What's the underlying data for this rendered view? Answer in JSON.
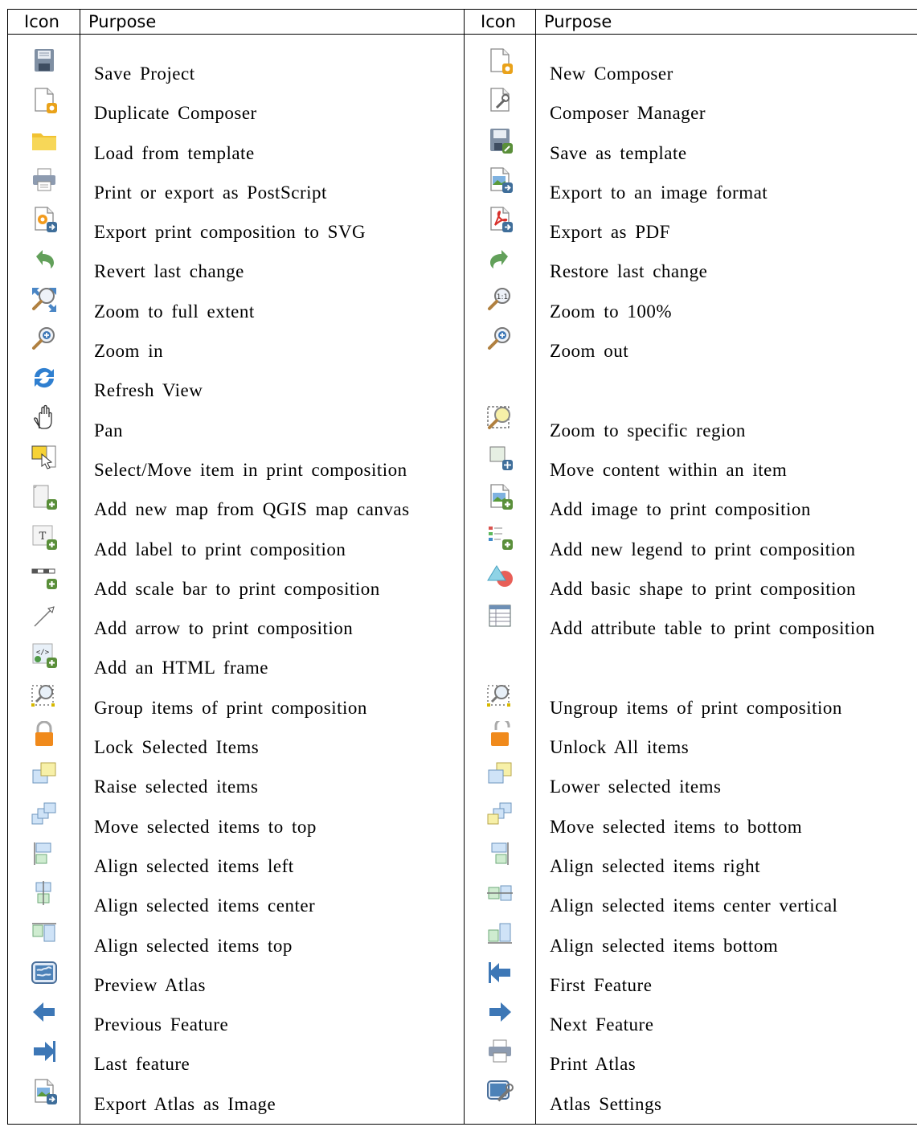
{
  "header": {
    "icon_col_1": "Icon",
    "purpose_col_1": "Purpose",
    "icon_col_2": "Icon",
    "purpose_col_2": "Purpose"
  },
  "rows": [
    {
      "left": {
        "icon": "save-project-icon",
        "label": "Save Project"
      },
      "right": {
        "icon": "new-composer-icon",
        "label": "New Composer"
      }
    },
    {
      "left": {
        "icon": "duplicate-composer-icon",
        "label": "Duplicate Composer"
      },
      "right": {
        "icon": "composer-manager-icon",
        "label": "Composer Manager"
      }
    },
    {
      "left": {
        "icon": "folder-icon",
        "label": "Load from template"
      },
      "right": {
        "icon": "save-template-icon",
        "label": "Save as template"
      }
    },
    {
      "left": {
        "icon": "printer-icon",
        "label": "Print or export as PostScript"
      },
      "right": {
        "icon": "export-image-icon",
        "label": "Export to an image format"
      }
    },
    {
      "left": {
        "icon": "export-svg-icon",
        "label": "Export print composition to SVG"
      },
      "right": {
        "icon": "export-pdf-icon",
        "label": "Export as PDF"
      }
    },
    {
      "left": {
        "icon": "undo-icon",
        "label": "Revert last change"
      },
      "right": {
        "icon": "redo-icon",
        "label": "Restore last change"
      }
    },
    {
      "left": {
        "icon": "zoom-full-icon",
        "label": "Zoom to full extent"
      },
      "right": {
        "icon": "zoom-actual-icon",
        "label": "Zoom to 100%"
      }
    },
    {
      "left": {
        "icon": "zoom-in-icon",
        "label": "Zoom in"
      },
      "right": {
        "icon": "zoom-out-icon",
        "label": "Zoom out"
      }
    },
    {
      "left": {
        "icon": "refresh-icon",
        "label": "Refresh View"
      },
      "right": {
        "icon": "",
        "label": ""
      }
    },
    {
      "left": {
        "icon": "pan-hand-icon",
        "label": "Pan"
      },
      "right": {
        "icon": "zoom-region-icon",
        "label": "Zoom to specific region"
      }
    },
    {
      "left": {
        "icon": "select-move-icon",
        "label": "Select/Move item in print composition"
      },
      "right": {
        "icon": "move-content-icon",
        "label": "Move content within an item"
      }
    },
    {
      "left": {
        "icon": "add-map-icon",
        "label": "Add new map from QGIS map canvas"
      },
      "right": {
        "icon": "add-image-icon",
        "label": "Add image to print composition"
      }
    },
    {
      "left": {
        "icon": "add-label-icon",
        "label": "Add label to print composition"
      },
      "right": {
        "icon": "add-legend-icon",
        "label": "Add new legend to print composition"
      }
    },
    {
      "left": {
        "icon": "add-scalebar-icon",
        "label": "Add scale bar to print composition"
      },
      "right": {
        "icon": "add-shape-icon",
        "label": "Add basic shape to print composition"
      }
    },
    {
      "left": {
        "icon": "add-arrow-icon",
        "label": "Add arrow to print composition"
      },
      "right": {
        "icon": "add-table-icon",
        "label": "Add attribute table to print composition"
      }
    },
    {
      "left": {
        "icon": "add-html-icon",
        "label": "Add an HTML frame"
      },
      "right": {
        "icon": "",
        "label": ""
      }
    },
    {
      "left": {
        "icon": "group-items-icon",
        "label": "Group items of print composition"
      },
      "right": {
        "icon": "ungroup-items-icon",
        "label": "Ungroup items of print composition"
      }
    },
    {
      "left": {
        "icon": "lock-icon",
        "label": "Lock Selected Items"
      },
      "right": {
        "icon": "unlock-icon",
        "label": "Unlock All items"
      }
    },
    {
      "left": {
        "icon": "raise-icon",
        "label": "Raise selected items"
      },
      "right": {
        "icon": "lower-icon",
        "label": "Lower selected items"
      }
    },
    {
      "left": {
        "icon": "move-top-icon",
        "label": "Move selected items to top"
      },
      "right": {
        "icon": "move-bottom-icon",
        "label": "Move selected items to bottom"
      }
    },
    {
      "left": {
        "icon": "align-left-icon",
        "label": "Align selected items left"
      },
      "right": {
        "icon": "align-right-icon",
        "label": "Align selected items right"
      }
    },
    {
      "left": {
        "icon": "align-center-icon",
        "label": "Align selected items center"
      },
      "right": {
        "icon": "align-vcenter-icon",
        "label": "Align selected items center vertical"
      }
    },
    {
      "left": {
        "icon": "align-top-icon",
        "label": "Align selected items top"
      },
      "right": {
        "icon": "align-bottom-icon",
        "label": "Align selected items bottom"
      }
    },
    {
      "left": {
        "icon": "atlas-preview-icon",
        "label": "Preview Atlas"
      },
      "right": {
        "icon": "first-feature-icon",
        "label": "First Feature"
      }
    },
    {
      "left": {
        "icon": "previous-feature-icon",
        "label": "Previous Feature"
      },
      "right": {
        "icon": "next-feature-icon",
        "label": "Next Feature"
      }
    },
    {
      "left": {
        "icon": "last-feature-icon",
        "label": "Last feature"
      },
      "right": {
        "icon": "print-atlas-icon",
        "label": "Print Atlas"
      }
    },
    {
      "left": {
        "icon": "export-atlas-image-icon",
        "label": "Export Atlas as Image"
      },
      "right": {
        "icon": "atlas-settings-icon",
        "label": "Atlas Settings"
      }
    }
  ]
}
